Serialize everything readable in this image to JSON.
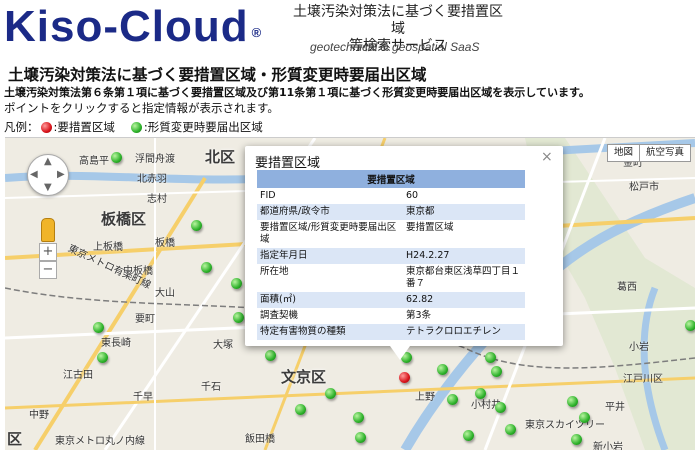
{
  "header": {
    "logo_text": "Kiso-Cloud",
    "logo_mark": "®",
    "tagline_jp_line1": "土壌汚染対策法に基づく要措置区域",
    "tagline_jp_line2": "等検索サービス",
    "tagline_en": "geotechnical & geospatial SaaS"
  },
  "page": {
    "title": "土壌汚染対策法に基づく要措置区域・形質変更時要届出区域",
    "description": "土壌汚染対策法第６条第１項に基づく要措置区域及び第11条第１項に基づく形質変更時要届出区域を表示しています。",
    "hint": "ポイントをクリックすると指定情報が表示されます。",
    "legend_prefix": "凡例：",
    "legend_red": ":要措置区域",
    "legend_green": ":形質変更時要届出区域"
  },
  "map": {
    "type_buttons": [
      "地図",
      "航空写真"
    ],
    "ward_labels": [
      "板橋区",
      "文京区",
      "北区",
      "区"
    ],
    "place_labels": [
      "高島平",
      "浮間舟渡",
      "北赤羽",
      "志村",
      "板橋",
      "上板橋",
      "東京メトロ有楽町線",
      "中板橋",
      "大山",
      "東長崎",
      "江古田",
      "要町",
      "千早",
      "上野",
      "東京スカイツリー",
      "平井",
      "江戸川区",
      "小岩",
      "葛西",
      "小村井",
      "金町",
      "松戸市",
      "新小岩",
      "東京メトロ丸ノ内線",
      "中野",
      "千石",
      "大塚",
      "飯田橋"
    ],
    "zoom_in": "+",
    "zoom_out": "−"
  },
  "popup": {
    "title": "要措置区域",
    "close_label": "×",
    "table_header": "要措置区域",
    "rows": [
      {
        "key": "FID",
        "value": "60"
      },
      {
        "key": "都道府県/政令市",
        "value": "東京都"
      },
      {
        "key": "要措置区域/形質変更時要届出区域",
        "value": "要措置区域"
      },
      {
        "key": "指定年月日",
        "value": "H24.2.27"
      },
      {
        "key": "所在地",
        "value": "東京都台東区浅草四丁目１番７"
      },
      {
        "key": "面積(㎡)",
        "value": "62.82"
      },
      {
        "key": "調査契機",
        "value": "第3条"
      },
      {
        "key": "特定有害物質の種類",
        "value": "テトラクロロエチレン"
      }
    ]
  },
  "colors": {
    "logo": "#1b2a87",
    "marker_red": "#d8141b",
    "marker_green": "#2db22a",
    "popup_header": "#8fb0de",
    "popup_row_alt": "#dbe6f6"
  }
}
